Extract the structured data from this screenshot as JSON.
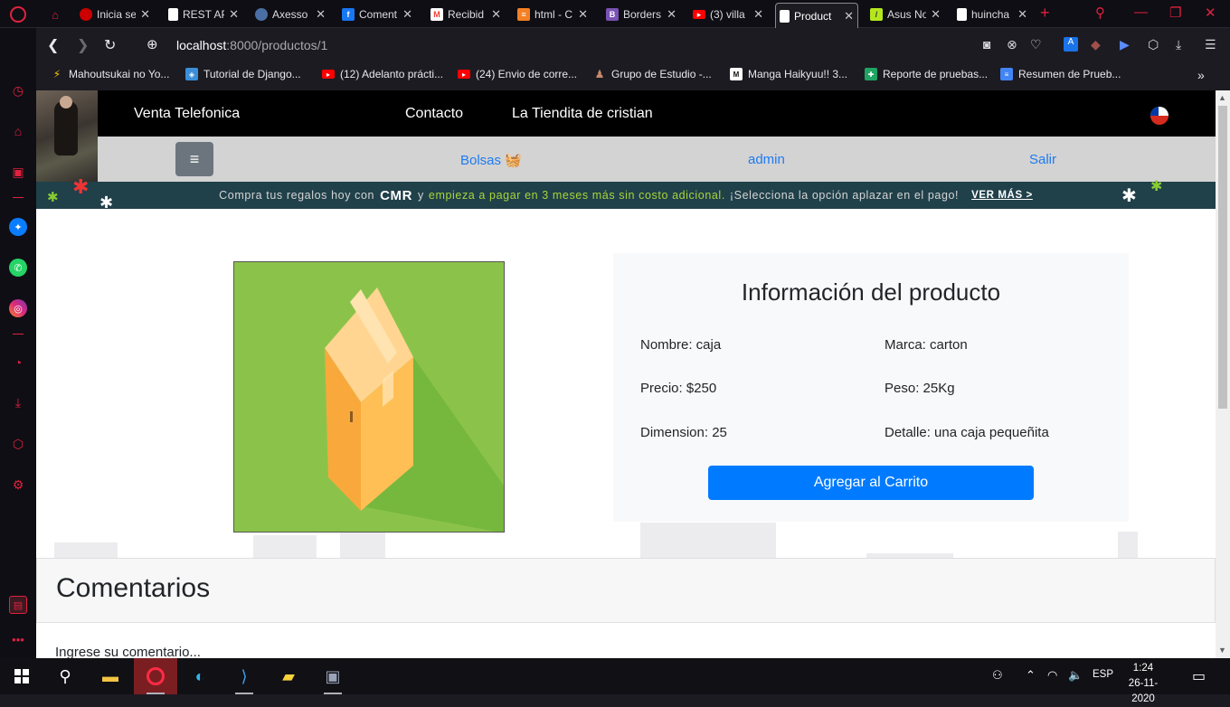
{
  "browser": {
    "tabs": [
      {
        "title": "Inicia se",
        "favicon_color": "#cc0000"
      },
      {
        "title": "REST AP",
        "favicon_color": "#ffffff"
      },
      {
        "title": "Axesso",
        "favicon_color": "#4a6fa5"
      },
      {
        "title": "Coment",
        "favicon_color": "#1877f2"
      },
      {
        "title": "Recibid",
        "favicon_color": "#ea4335"
      },
      {
        "title": "html - C",
        "favicon_color": "#f48024"
      },
      {
        "title": "Borders",
        "favicon_color": "#7952b3"
      },
      {
        "title": "(3) villa",
        "favicon_color": "#ff0000"
      },
      {
        "title": "Product",
        "favicon_color": "#ffffff",
        "active": true
      },
      {
        "title": "Asus No",
        "favicon_color": "#b5e61d"
      },
      {
        "title": "huincha",
        "favicon_color": "#ffffff"
      }
    ],
    "url_host": "localhost",
    "url_path": ":8000/productos/1",
    "bookmarks": [
      {
        "label": "Mahoutsukai no Yo...",
        "icon_color": "#f2c200"
      },
      {
        "label": "Tutorial de Django...",
        "icon_color": "#3a8fd8"
      },
      {
        "label": "(12) Adelanto prácti...",
        "icon_color": "#ff0000"
      },
      {
        "label": "(24) Envio de corre...",
        "icon_color": "#ff0000"
      },
      {
        "label": "Grupo de Estudio -...",
        "icon_color": "#8a5a44"
      },
      {
        "label": "Manga Haikyuu!! 3...",
        "icon_color": "#222222"
      },
      {
        "label": "Reporte de pruebas...",
        "icon_color": "#1fa463"
      },
      {
        "label": "Resumen de Prueb...",
        "icon_color": "#4285f4"
      }
    ],
    "accent": "#e0213f"
  },
  "site": {
    "nav_top": {
      "brand": "Venta Telefonica",
      "contact": "Contacto",
      "store": "La Tiendita de cristian"
    },
    "nav_second": {
      "menu_icon": "≡",
      "bags": "Bolsas",
      "admin": "admin",
      "logout": "Salir"
    },
    "promo": {
      "prefix": "Compra tus regalos hoy con",
      "brand": "CMR",
      "connector": "y",
      "highlight": "empieza a pagar en 3 meses más sin costo adicional.",
      "suffix": "¡Selecciona la opción aplazar en el pago!",
      "cta": "VER MÁS >"
    },
    "product": {
      "heading": "Información del producto",
      "name": "Nombre: caja",
      "brand": "Marca: carton",
      "price": "Precio: $250",
      "weight": "Peso: 25Kg",
      "dimension": "Dimension: 25",
      "detail": "Detalle: una caja pequeñita",
      "add_button": "Agregar al Carrito",
      "image_bg": "#8bc34a"
    },
    "comments": {
      "heading": "Comentarios",
      "prompt": "Ingrese su comentario..."
    },
    "colors": {
      "link": "#1e7bf2",
      "primary_button": "#007bff"
    }
  },
  "taskbar": {
    "language": "ESP",
    "time": "1:24",
    "date": "26-11-2020"
  }
}
